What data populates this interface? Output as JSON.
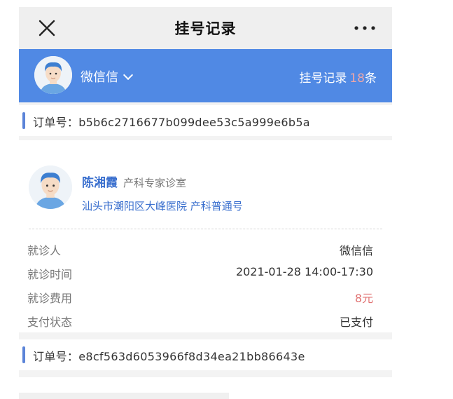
{
  "nav": {
    "title": "挂号记录",
    "close_icon": "close-icon",
    "more_icon": "more-icon"
  },
  "user_bar": {
    "user_name": "微信信",
    "dropdown_icon": "chevron-down-icon",
    "record_label": "挂号记录",
    "record_count": "18",
    "record_unit": "条",
    "background_color": "#5089e4"
  },
  "orders": [
    {
      "label": "订单号：",
      "number": "b5b6c2716677b099dee53c5a999e6b5a"
    },
    {
      "label": "订单号：",
      "number": "e8cf563d6053966f8d34ea21bb86643e"
    }
  ],
  "appointment": {
    "doctor_name": "陈湘霞",
    "department": "产科专家诊室",
    "hospital": "汕头市潮阳区大峰医院 产科普通号",
    "rows": [
      {
        "label": "就诊人",
        "value": "微信信"
      },
      {
        "label": "就诊时间",
        "value": "2021-01-28 14:00-17:30"
      },
      {
        "label": "就诊费用",
        "value": "8元"
      },
      {
        "label": "支付状态",
        "value": "已支付"
      }
    ]
  },
  "colors": {
    "accent": "#3a6fce",
    "fee": "#e07070",
    "order_marker": "#5b84d8"
  }
}
